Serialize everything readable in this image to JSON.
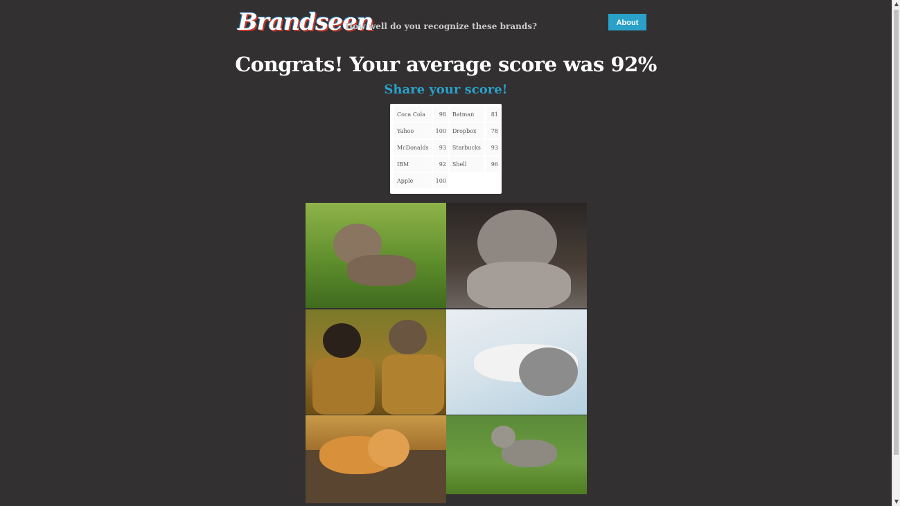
{
  "header": {
    "logo_text": "Brandseen",
    "tagline": "How well do you recognize these brands?",
    "about_label": "About"
  },
  "main": {
    "headline": "Congrats! Your average score was 92%",
    "share_label": "Share your score!"
  },
  "scores": [
    {
      "brand": "Coca Cola",
      "score": "98"
    },
    {
      "brand": "Batman",
      "score": "81"
    },
    {
      "brand": "Yahoo",
      "score": "100"
    },
    {
      "brand": "Dropbox",
      "score": "78"
    },
    {
      "brand": "McDonalds",
      "score": "93"
    },
    {
      "brand": "Starbucks",
      "score": "93"
    },
    {
      "brand": "IBM",
      "score": "92"
    },
    {
      "brand": "Shell",
      "score": "96"
    },
    {
      "brand": "Apple",
      "score": "100"
    }
  ],
  "colors": {
    "background": "#323031",
    "accent": "#2aa1c9",
    "headline": "#ffffff"
  }
}
